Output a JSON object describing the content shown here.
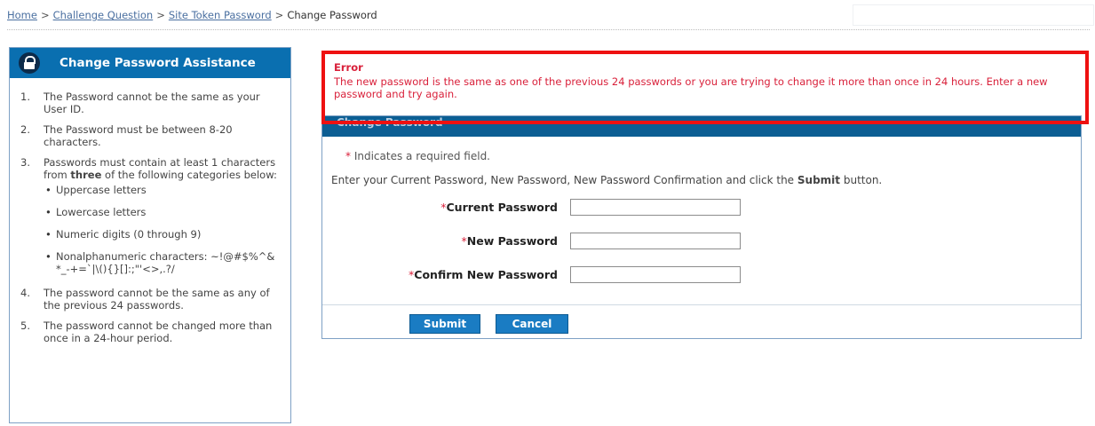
{
  "breadcrumb": {
    "items": [
      "Home",
      "Challenge Question",
      "Site Token Password"
    ],
    "separator": ">",
    "current": "Change Password"
  },
  "sidebar": {
    "title": "Change Password Assistance",
    "icon": "lock-icon",
    "rules": [
      {
        "num": "1.",
        "text": "The Password cannot be the same as your User ID."
      },
      {
        "num": "2.",
        "text": "The Password must be between 8-20 characters."
      },
      {
        "num": "3.",
        "text_before": "Passwords must contain at least 1 characters from ",
        "bold": "three",
        "text_after": " of the following categories below:",
        "categories": [
          "Uppercase letters",
          "Lowercase letters",
          "Numeric digits (0 through 9)",
          "Nonalphanumeric characters: ~!@#$%^&*_-+=`|\\(){}[]:;\"'<>,.?/"
        ]
      },
      {
        "num": "4.",
        "text": "The password cannot be the same as any of the previous 24 passwords."
      },
      {
        "num": "5.",
        "text": "The password cannot be changed more than once in a 24-hour period."
      }
    ]
  },
  "error": {
    "title": "Error",
    "message": "The new password is the same as one of the previous 24 passwords or you are trying to change it more than once in 24 hours. Enter a new password and try again."
  },
  "form": {
    "title": "Change Password",
    "required_star": "*",
    "required_note": "Indicates a required field.",
    "instruction_before": "Enter your Current Password, New Password, New Password Confirmation and click the ",
    "instruction_bold": "Submit",
    "instruction_after": " button.",
    "fields": [
      {
        "label": "Current Password",
        "value": ""
      },
      {
        "label": "New Password",
        "value": ""
      },
      {
        "label": "Confirm New Password",
        "value": ""
      }
    ],
    "submit_label": "Submit",
    "cancel_label": "Cancel"
  },
  "colors": {
    "header_blue": "#0a6fb0",
    "error_red": "#d9203a",
    "error_border": "#ee1111",
    "button_blue": "#1a7cc3"
  }
}
